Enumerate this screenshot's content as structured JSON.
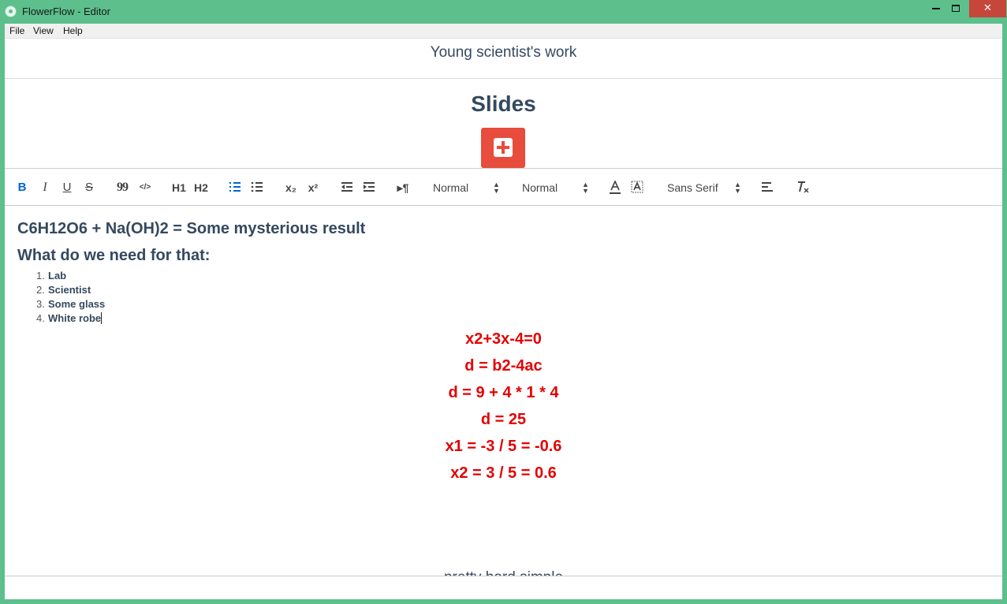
{
  "window": {
    "title": "FlowerFlow - Editor",
    "controls": {
      "close": "✕"
    }
  },
  "menu": {
    "items": [
      "File",
      "View",
      "Help"
    ]
  },
  "header": {
    "title": "Young scientist's work"
  },
  "slides": {
    "heading": "Slides"
  },
  "toolbar": {
    "buttons": {
      "bold": "B",
      "italic": "I",
      "underline": "U",
      "strike": "S",
      "quote": "99",
      "code": "</>",
      "h1": "H1",
      "h2": "H2",
      "sub": "x₂",
      "sup": "x²",
      "para": "▸¶"
    },
    "header_select": "Normal",
    "size_select": "Normal",
    "font_select": "Sans Serif"
  },
  "content": {
    "title": "C6H12O6 + Na(OH)2 = Some mysterious result",
    "subtitle": "What do we need for that:",
    "list": [
      {
        "num": "1.",
        "text": "Lab"
      },
      {
        "num": "2.",
        "text": "Scientist"
      },
      {
        "num": "3.",
        "text": "Some glass"
      },
      {
        "num": "4.",
        "text": "White robe"
      }
    ],
    "math": [
      "x2+3x-4=0",
      "d = b2-4ac",
      "d = 9 + 4 * 1 * 4",
      "d = 25",
      "x1 = -3 / 5 = -0.6",
      "x2 = 3 / 5 = 0.6"
    ],
    "footer": {
      "before": "pretty ",
      "struck": "hard",
      "after": " simple"
    }
  }
}
